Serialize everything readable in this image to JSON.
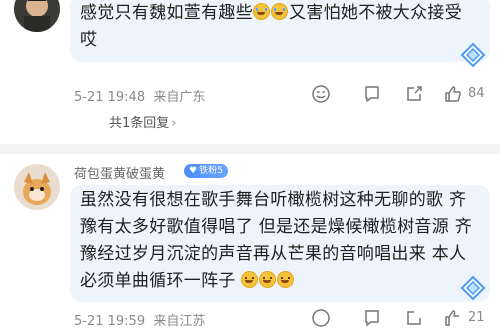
{
  "comments": [
    {
      "username": "",
      "text_line1": "感觉只有魏如萱有趣些",
      "text_line1_tail": "又害怕她不被大众接受",
      "text_line2": "哎",
      "timestamp": "5-21 19:48",
      "location": "来自广东",
      "like_count": "84",
      "replies_label": "共1条回复",
      "emojis": [
        "crying-face",
        "crying-face"
      ]
    },
    {
      "username": "荷包蛋黄破蛋黄",
      "badge": "铁粉5",
      "lines": [
        "虽然没有很想在歌手舞台听橄榄树这种无聊的歌 齐",
        "豫有太多好歌值得唱了 但是还是燥候橄榄树音源 齐",
        "豫经过岁月沉淀的声音再从芒果的音响唱出来 本人",
        "必须单曲循环一阵子"
      ],
      "emojis": [
        "grinning-sweat-face",
        "grinning-sweat-face",
        "grinning-sweat-face"
      ],
      "timestamp": "5-21 19:59",
      "location": "来自江苏",
      "like_count": "21"
    }
  ],
  "colors": {
    "bubble_bg": "#eef4fb",
    "meta_text": "#8a8a8a",
    "badge_blue": "#4b8dfa"
  },
  "icons": [
    "emoji-reaction-icon",
    "reply-comment-icon",
    "share-icon",
    "like-icon",
    "diamond-bounce-icon"
  ]
}
